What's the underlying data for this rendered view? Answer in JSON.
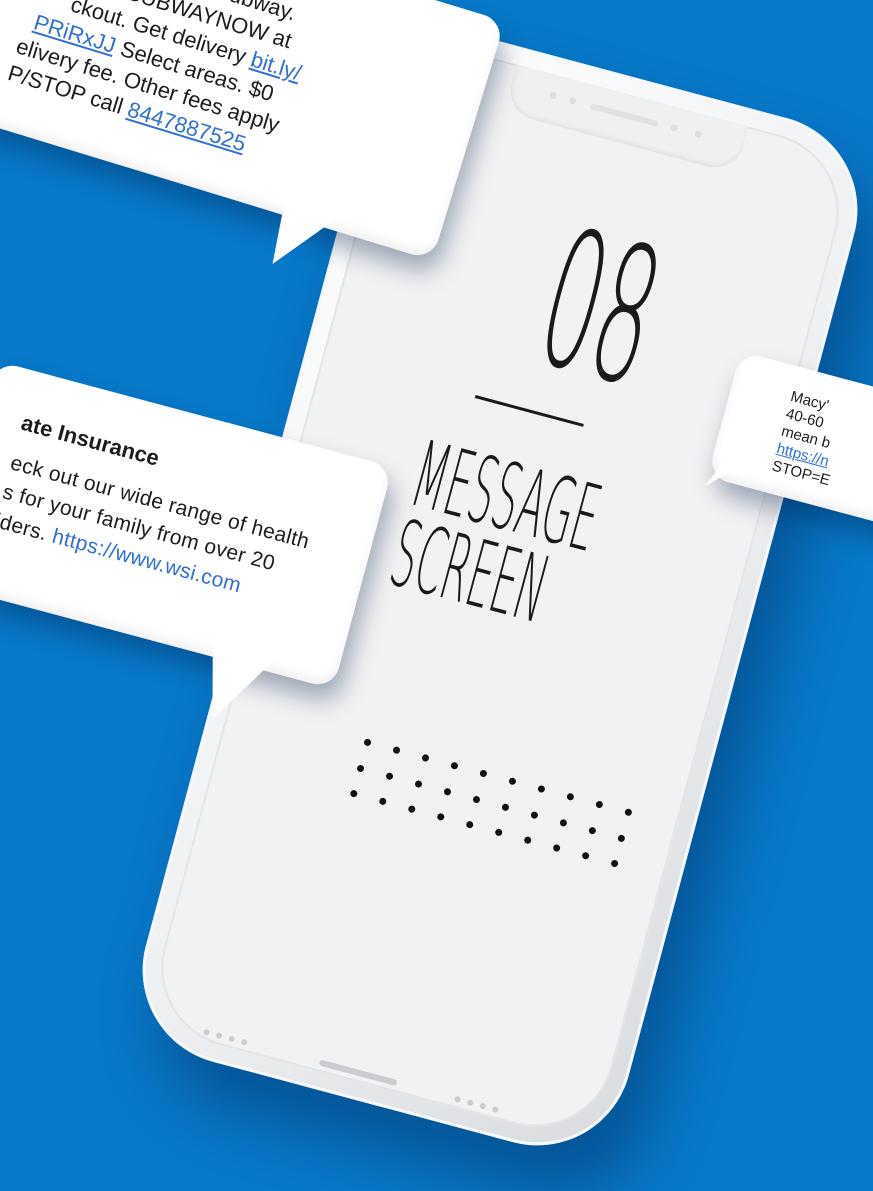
{
  "screen": {
    "number": "08",
    "title_line1": "MESSAGE",
    "title_line2": "SCREEN"
  },
  "bubble_subway": {
    "line1": "m Subway.",
    "line2": "SUBWAYNOW at",
    "line3a": "ckout. Get delivery ",
    "line3_link": "bit.ly/",
    "line4_link": "PRiRxJJ",
    "line4b": " Select areas. $0",
    "line5": "elivery fee. Other fees apply",
    "line6a": "P/STOP call ",
    "line6_link": "8447887525"
  },
  "bubble_insurance": {
    "title": "ate Insurance",
    "line1": "eck out our wide range of health",
    "line2": "s for your family from over 20",
    "line3a": "iders. ",
    "line3_link": "https://www.wsi.com"
  },
  "bubble_macys": {
    "line1": "Macy'",
    "line2": "40-60",
    "line3": "mean b",
    "line4_link": "https://n",
    "line5": "STOP=E"
  },
  "colors": {
    "background": "#0878c8",
    "link": "#2f6fd6"
  }
}
